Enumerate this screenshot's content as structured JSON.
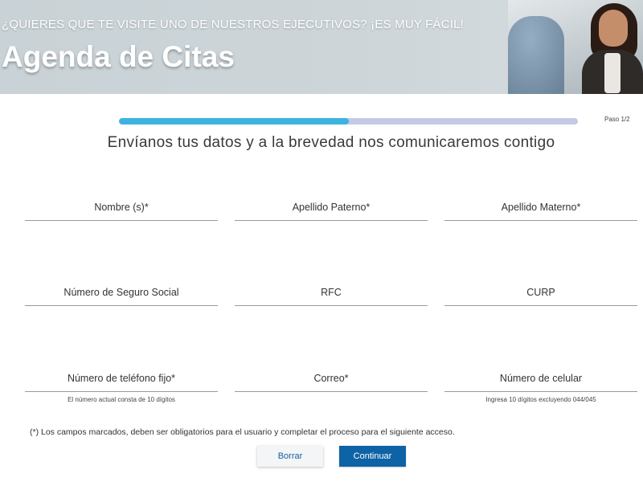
{
  "hero": {
    "subtitle": "¿QUIERES QUE TE VISITE UNO DE NUESTROS EJECUTIVOS? ¡ES MUY FÁCIL!",
    "title": "Agenda de Citas"
  },
  "progress": {
    "value": 0.5,
    "step_label": "Paso 1/2",
    "fill_color": "#3db3e0",
    "track_color": "#c6c9e4"
  },
  "heading": "Envíanos tus datos y a la brevedad nos comunicaremos contigo",
  "form": {
    "nombre": {
      "label": "Nombre (s)*"
    },
    "apellido_paterno": {
      "label": "Apellido Paterno*"
    },
    "apellido_materno": {
      "label": "Apellido Materno*"
    },
    "nss": {
      "label": "Número de Seguro Social"
    },
    "rfc": {
      "label": "RFC"
    },
    "curp": {
      "label": "CURP"
    },
    "telefono": {
      "label": "Número de teléfono fijo*",
      "hint": "El número actual consta de 10 dígitos"
    },
    "correo": {
      "label": "Correo*"
    },
    "celular": {
      "label": "Número de celular",
      "hint": "Ingresa 10 dígitos excluyendo 044/045"
    }
  },
  "note": "(*) Los campos marcados, deben ser obligatorios para el usuario y completar el proceso para el siguiente acceso.",
  "buttons": {
    "clear": "Borrar",
    "continue": "Continuar"
  },
  "colors": {
    "primary_button": "#0e62a6",
    "secondary_button_text": "#1a5fa0"
  }
}
